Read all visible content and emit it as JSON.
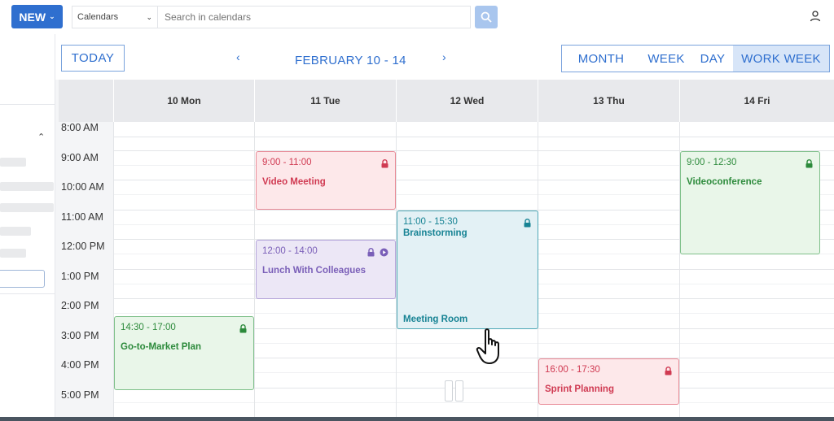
{
  "header": {
    "new_label": "NEW",
    "calendar_select": "Calendars",
    "search_placeholder": "Search in calendars"
  },
  "toolbar": {
    "today_label": "TODAY",
    "range_title": "FEBRUARY 10 - 14",
    "views": [
      {
        "label": "MONTH",
        "active": false
      },
      {
        "label": "WEEK",
        "active": false
      },
      {
        "label": "DAY",
        "active": false
      },
      {
        "label": "WORK WEEK",
        "active": true
      }
    ]
  },
  "days": [
    "10 Mon",
    "11 Tue",
    "12 Wed",
    "13 Thu",
    "14 Fri"
  ],
  "times": [
    "8:00 AM",
    "9:00 AM",
    "10:00 AM",
    "11:00 AM",
    "12:00 PM",
    "1:00 PM",
    "2:00 PM",
    "3:00 PM",
    "4:00 PM",
    "5:00 PM"
  ],
  "events": [
    {
      "time": "9:00 - 11:00",
      "title": "Video Meeting"
    },
    {
      "time": "9:00 - 12:30",
      "title": "Videoconference"
    },
    {
      "time": "11:00 - 15:30",
      "title": "Brainstorming",
      "location": "Meeting Room"
    },
    {
      "time": "12:00 - 14:00",
      "title": "Lunch With Colleagues"
    },
    {
      "time": "14:30 - 17:00",
      "title": "Go-to-Market Plan"
    },
    {
      "time": "16:00 - 17:30",
      "title": "Sprint Planning"
    }
  ],
  "colors": {
    "accent": "#2f6fcf",
    "event_red": "#d03a52",
    "event_green": "#2c8a3b",
    "event_purple": "#7a5fb8",
    "event_teal": "#178394"
  },
  "icons": [
    "chevron-down-icon",
    "search-icon",
    "user-icon",
    "chevron-up-icon",
    "chevron-left-icon",
    "chevron-right-icon",
    "lock-icon",
    "video-icon",
    "hand-cursor-icon"
  ]
}
